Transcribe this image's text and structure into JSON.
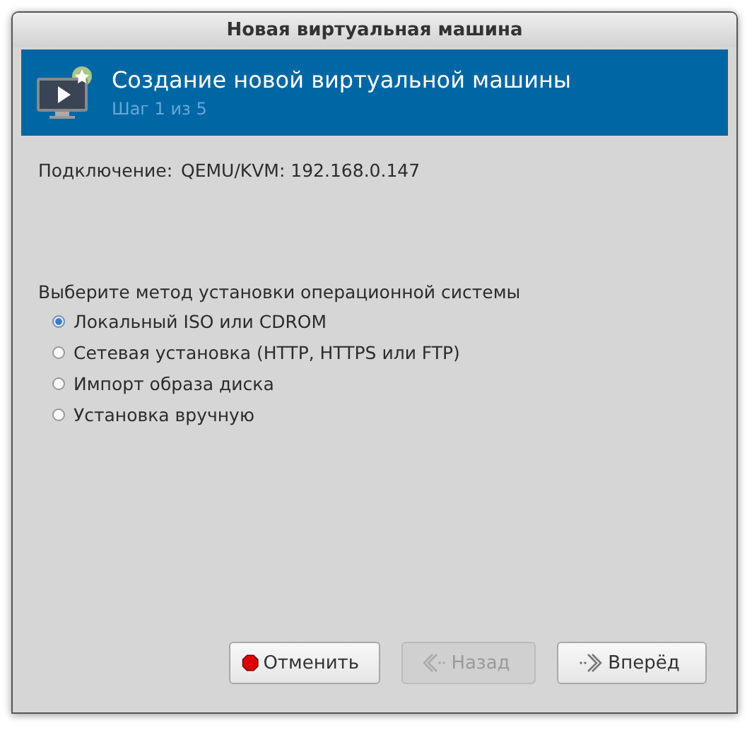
{
  "window": {
    "title": "Новая виртуальная машина"
  },
  "header": {
    "title": "Создание новой виртуальной машины",
    "subtitle": "Шаг 1 из 5"
  },
  "connection": {
    "label": "Подключение:",
    "value": "QEMU/KVM: 192.168.0.147"
  },
  "install_method": {
    "prompt": "Выберите метод установки операционной системы",
    "options": [
      {
        "label": "Локальный ISO или CDROM",
        "selected": true
      },
      {
        "label": "Сетевая установка (HTTP, HTTPS или FTP)",
        "selected": false
      },
      {
        "label": "Импорт образа диска",
        "selected": false
      },
      {
        "label": "Установка вручную",
        "selected": false
      }
    ]
  },
  "buttons": [
    {
      "kind": "cancel",
      "label": "Отменить",
      "disabled": false
    },
    {
      "kind": "back",
      "label": "Назад",
      "disabled": true
    },
    {
      "kind": "forward",
      "label": "Вперёд",
      "disabled": false
    }
  ]
}
